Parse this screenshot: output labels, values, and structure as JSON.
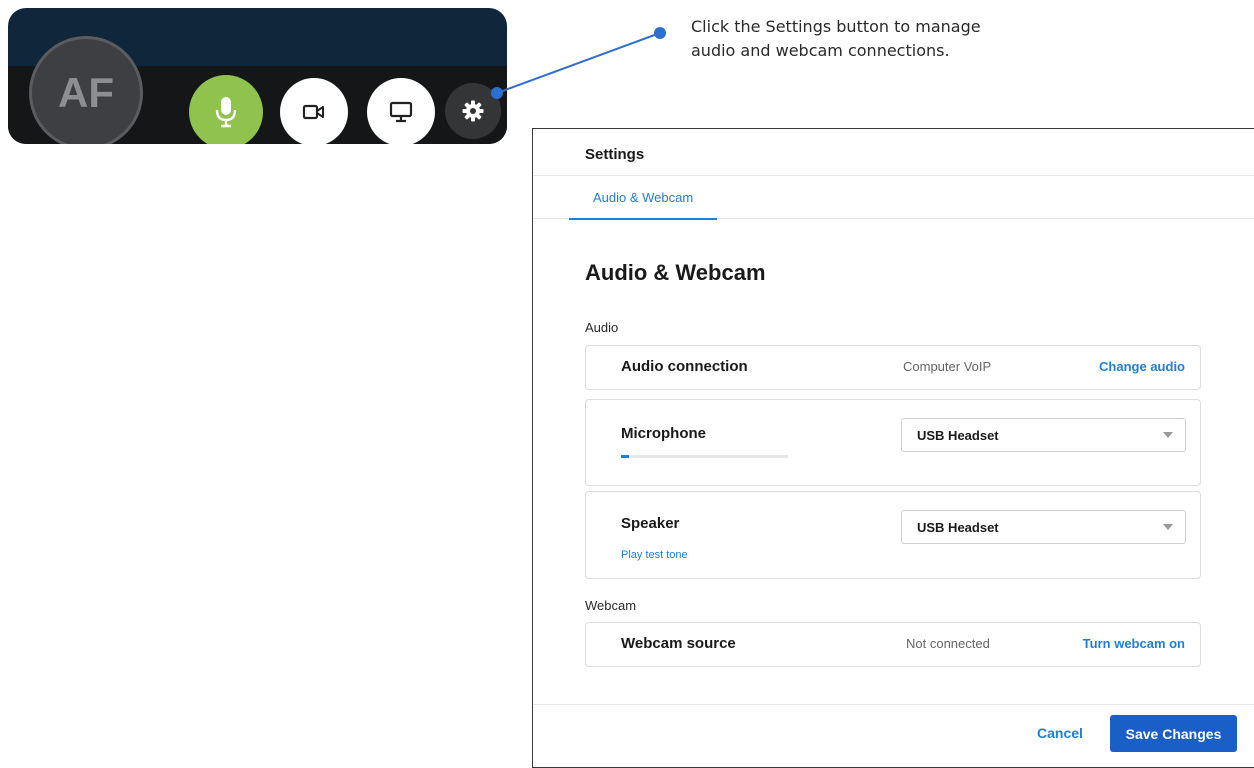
{
  "toolbar": {
    "avatar_initials": "AF",
    "buttons": [
      {
        "name": "microphone",
        "icon": "microphone-icon",
        "active": true
      },
      {
        "name": "camera",
        "icon": "video-camera-icon"
      },
      {
        "name": "screen-share",
        "icon": "monitor-icon"
      },
      {
        "name": "settings",
        "icon": "gear-icon"
      }
    ]
  },
  "callout": {
    "text": "Click the Settings button to manage audio and webcam connections."
  },
  "settings_panel": {
    "title": "Settings",
    "tabs": [
      {
        "label": "Audio & Webcam",
        "selected": true
      }
    ],
    "heading": "Audio & Webcam",
    "audio_group_label": "Audio",
    "audio_connection": {
      "label": "Audio connection",
      "value": "Computer VoIP",
      "action": "Change audio"
    },
    "microphone": {
      "label": "Microphone",
      "selected": "USB Headset",
      "level": 0.05
    },
    "speaker": {
      "label": "Speaker",
      "selected": "USB Headset",
      "test_link": "Play test tone"
    },
    "webcam_group_label": "Webcam",
    "webcam_source": {
      "label": "Webcam source",
      "value": "Not connected",
      "action": "Turn webcam on"
    },
    "footer": {
      "cancel_label": "Cancel",
      "save_label": "Save Changes"
    }
  },
  "colors": {
    "accent": "#1f7fd8",
    "primary_button": "#1a5fc7",
    "mic_active": "#8fc34e",
    "toolbar_bg": "#141617"
  }
}
